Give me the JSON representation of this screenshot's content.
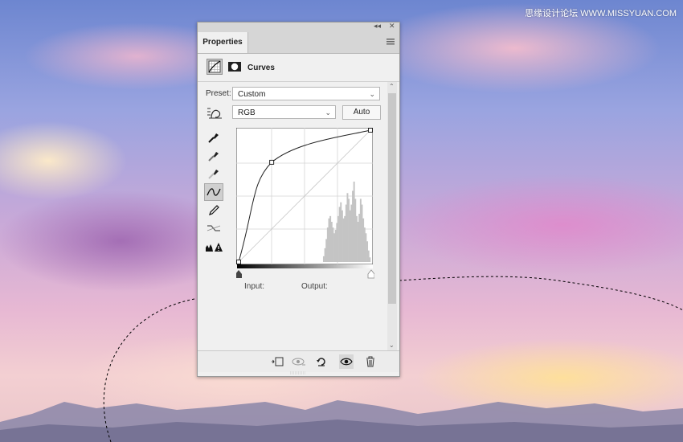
{
  "watermark": "思缘设计论坛 WWW.MISSYUAN.COM",
  "panel": {
    "tab_label": "Properties",
    "title": "Curves",
    "preset_label": "Preset:",
    "preset_value": "Custom",
    "channel_value": "RGB",
    "auto_label": "Auto",
    "input_label": "Input:",
    "output_label": "Output:"
  },
  "curve": {
    "points": [
      [
        0,
        0
      ],
      [
        64,
        193
      ],
      [
        255,
        255
      ]
    ],
    "histogram": [
      0,
      0,
      0,
      0,
      0,
      0,
      0,
      0,
      0,
      0,
      0,
      0,
      0,
      0,
      0,
      0,
      0,
      0,
      0,
      0,
      0,
      0,
      0,
      0,
      0,
      0,
      0,
      0,
      0,
      0,
      0,
      0,
      0,
      0,
      0,
      0,
      0,
      0,
      0,
      0,
      0,
      0,
      0,
      0,
      0,
      0,
      0,
      0,
      0,
      0,
      0,
      0,
      0,
      0,
      0,
      0,
      0,
      0,
      0,
      0,
      0,
      0,
      0,
      0,
      5,
      12,
      20,
      30,
      38,
      40,
      35,
      30,
      25,
      28,
      34,
      40,
      48,
      52,
      45,
      38,
      40,
      50,
      60,
      55,
      45,
      50,
      62,
      70,
      55,
      40,
      35,
      42,
      55,
      50,
      38,
      30,
      25,
      18,
      10,
      4
    ]
  },
  "colors": {
    "panel_bg": "#f0f0f0",
    "accent": "#2a2a2a"
  }
}
